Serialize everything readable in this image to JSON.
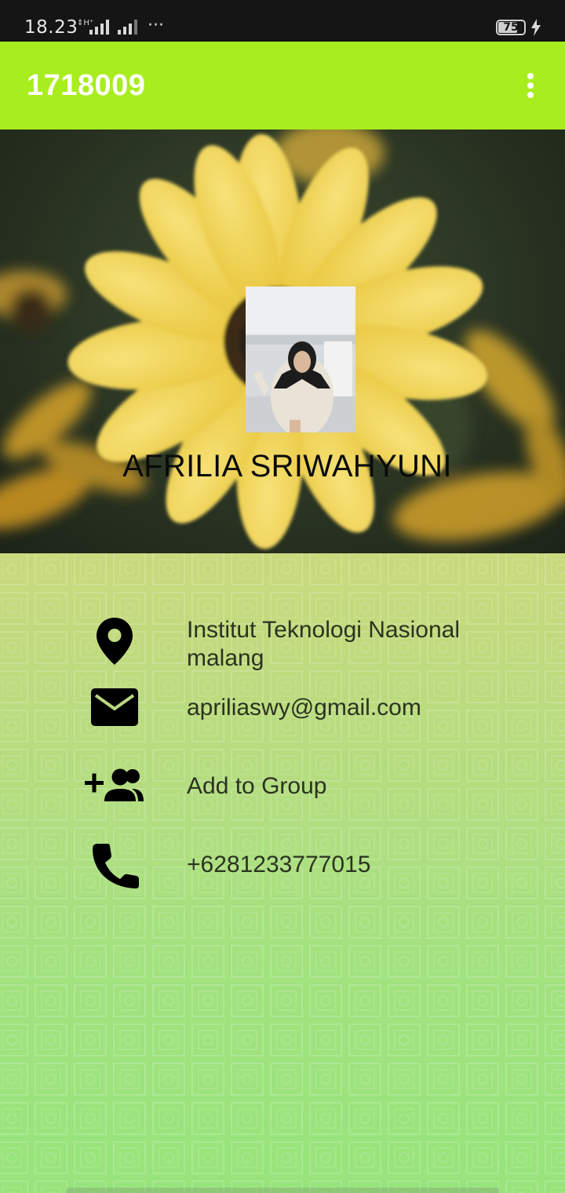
{
  "status_bar": {
    "time": "18.23",
    "more": "···",
    "battery_level": "75",
    "battery_fraction": 0.75
  },
  "app_bar": {
    "title": "1718009",
    "menu_icon": "more-vert-icon"
  },
  "profile": {
    "name": "AFRILIA SRIWAHYUNI"
  },
  "details": {
    "address": "Institut Teknologi Nasional malang",
    "email": "apriliaswy@gmail.com",
    "group": "Add to Group",
    "phone": "+6281233777015"
  },
  "icons": {
    "address": "location-pin-icon",
    "email": "mail-icon",
    "group": "group-add-icon",
    "phone": "phone-icon"
  },
  "colors": {
    "app_bar": "#a8ed1e",
    "status_bar": "#151515",
    "detail_text": "#2a3320"
  }
}
